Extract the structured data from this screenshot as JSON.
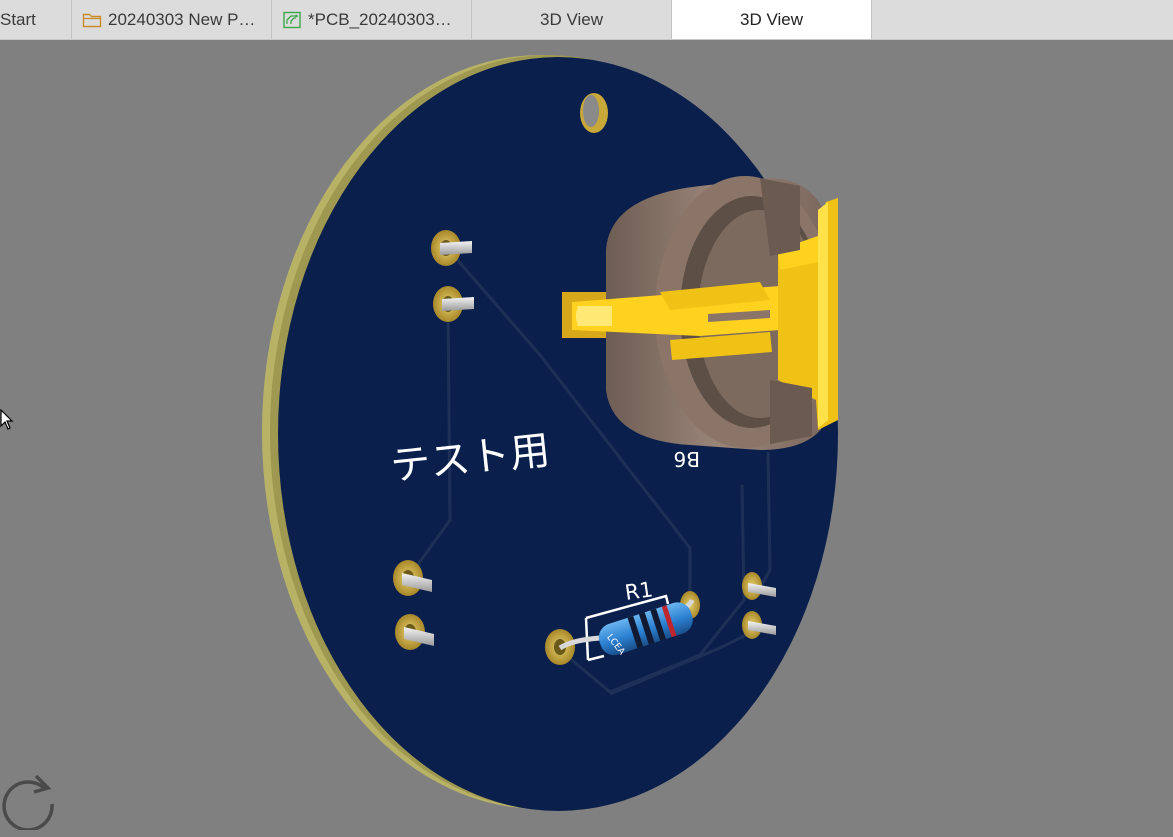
{
  "tabs": [
    {
      "label": "Start",
      "icon": "none"
    },
    {
      "label": "20240303 New P…",
      "icon": "folder-icon"
    },
    {
      "label": "*PCB_20240303…",
      "icon": "pcb-icon"
    },
    {
      "label": "3D View",
      "icon": "none"
    },
    {
      "label": "3D View",
      "icon": "none",
      "active": true
    }
  ],
  "board": {
    "silkscreen_text": "テスト用",
    "resistor_label": "R1",
    "resistor_body_text": "LCEA",
    "battery_label": "B6"
  },
  "colors": {
    "background": "#808080",
    "board_solder_mask": "#0a1f4b",
    "board_edge": "#b8b266",
    "pad_gold": "#c9a83a",
    "holder_brown": "#8a7568",
    "contact_yellow": "#ffd21f",
    "resistor_blue": "#2a7fd0"
  }
}
